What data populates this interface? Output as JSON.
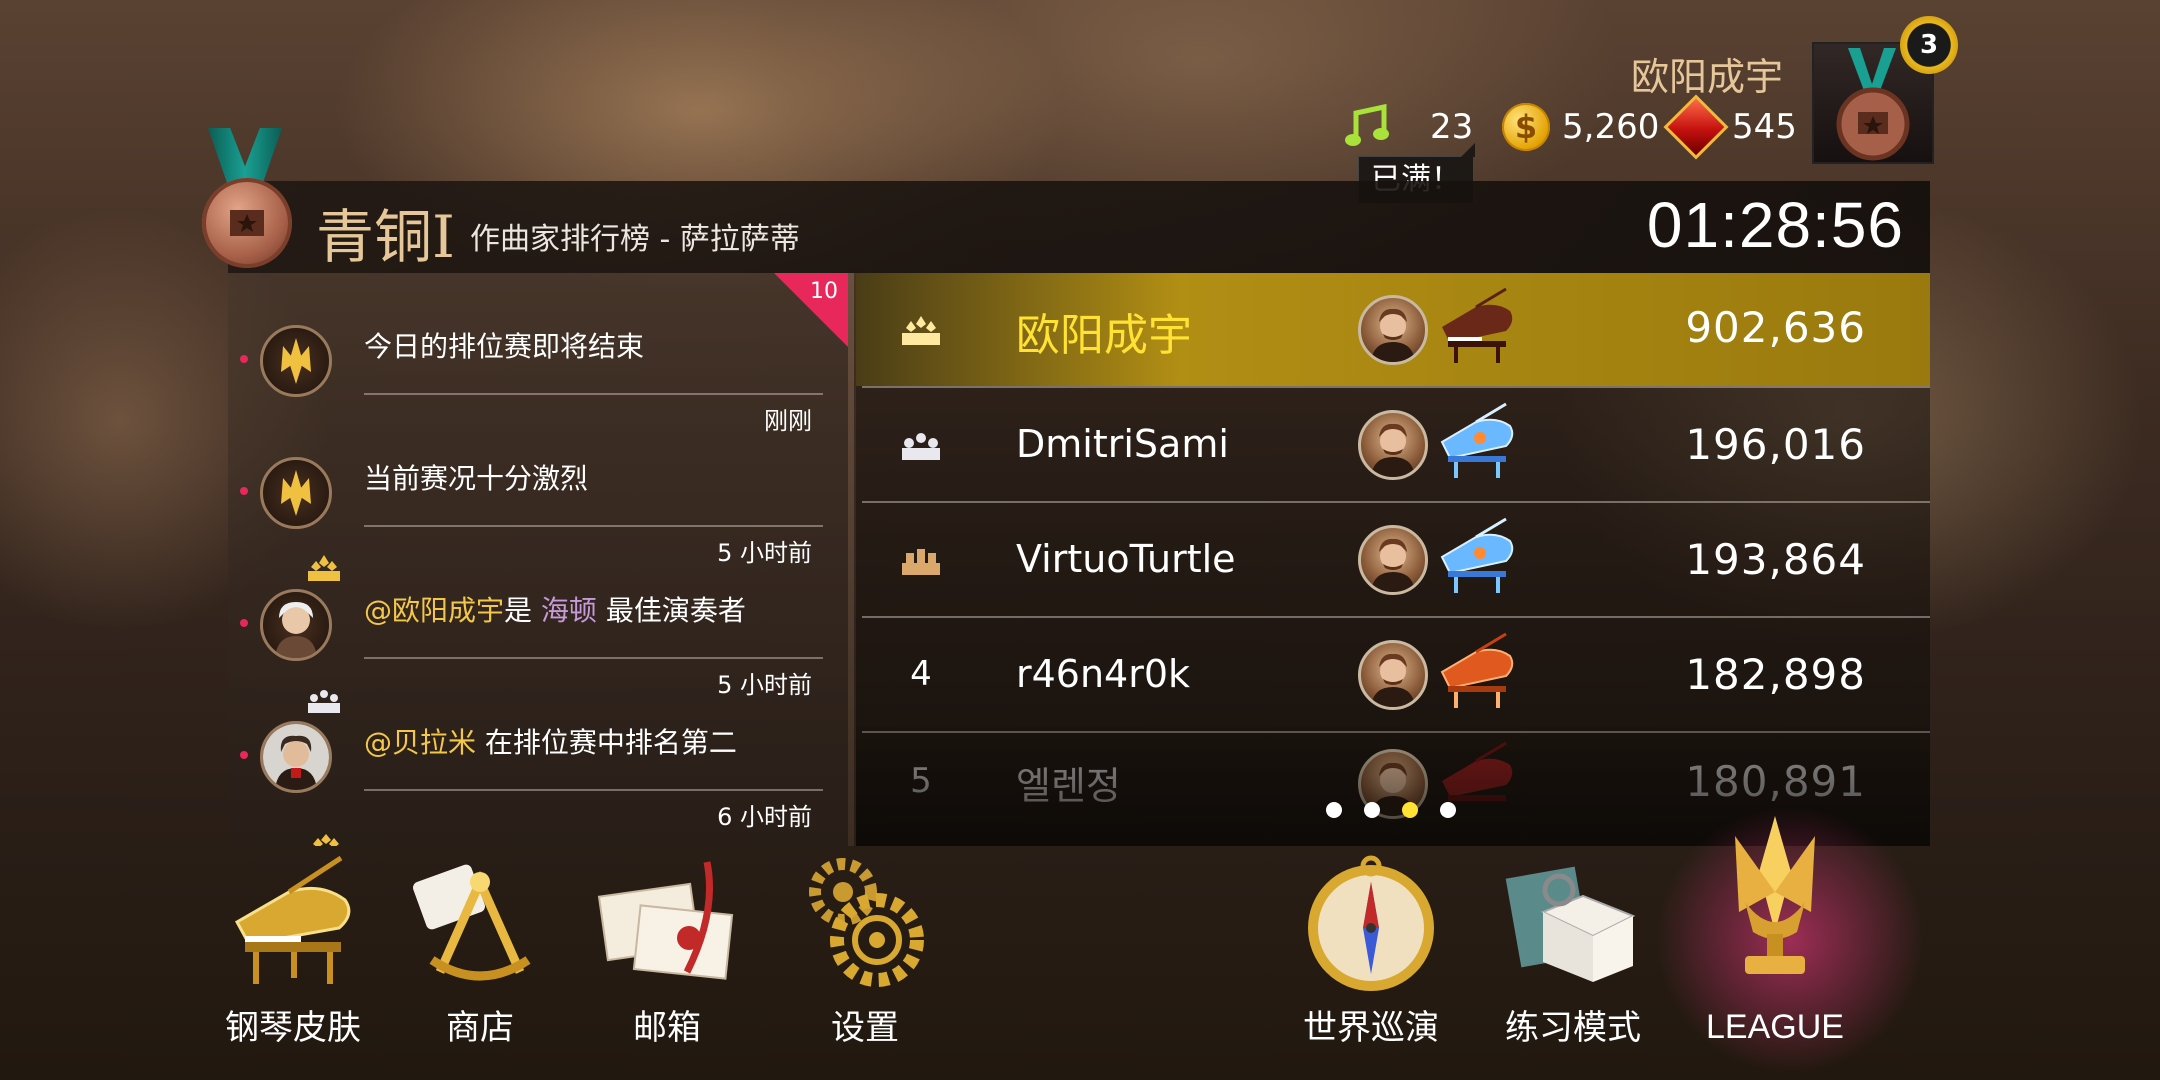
{
  "player": {
    "name": "欧阳成宇",
    "level": "3",
    "resources": {
      "notes": "23",
      "coins": "5,260",
      "gems": "545"
    },
    "notes_tooltip": "已满！"
  },
  "league": {
    "tier": "青铜I",
    "title": "作曲家排行榜 - 萨拉萨蒂",
    "timer": "01:28:56"
  },
  "feed": {
    "unread_count": "10",
    "items": [
      {
        "text": "今日的排位赛即将结束",
        "time": "刚刚"
      },
      {
        "text": "当前赛况十分激烈",
        "time": "5 小时前"
      },
      {
        "mention": "@欧阳成宇",
        "text_a": "是 ",
        "composer": "海顿",
        "text_b": " 最佳演奏者",
        "time": "5 小时前"
      },
      {
        "mention": "@贝拉米",
        "text_a": " 在排位赛中排名第二",
        "time": "6 小时前"
      }
    ]
  },
  "leaderboard": {
    "rows": [
      {
        "rank": "1",
        "name": "欧阳成宇",
        "score": "902,636"
      },
      {
        "rank": "2",
        "name": "DmitriSami",
        "score": "196,016"
      },
      {
        "rank": "3",
        "name": "VirtuoTurtle",
        "score": "193,864"
      },
      {
        "rank": "4",
        "name": "r46n4r0k",
        "score": "182,898"
      },
      {
        "rank": "5",
        "name": "엘렌정",
        "score": "180,891"
      }
    ],
    "page_count": 4,
    "current_page": 3
  },
  "menu": {
    "left": [
      {
        "label": "钢琴皮肤",
        "icon": "piano-icon"
      },
      {
        "label": "商店",
        "icon": "store-icon"
      },
      {
        "label": "邮箱",
        "icon": "mail-icon"
      },
      {
        "label": "设置",
        "icon": "gear-icon"
      }
    ],
    "right": [
      {
        "label": "世界巡演",
        "icon": "compass-icon"
      },
      {
        "label": "练习模式",
        "icon": "book-icon"
      },
      {
        "label": "LEAGUE",
        "icon": "trophy-icon"
      }
    ]
  },
  "colors": {
    "gold": "#ffe233",
    "pink": "#e8285a",
    "accent_text": "#e6c79a"
  }
}
